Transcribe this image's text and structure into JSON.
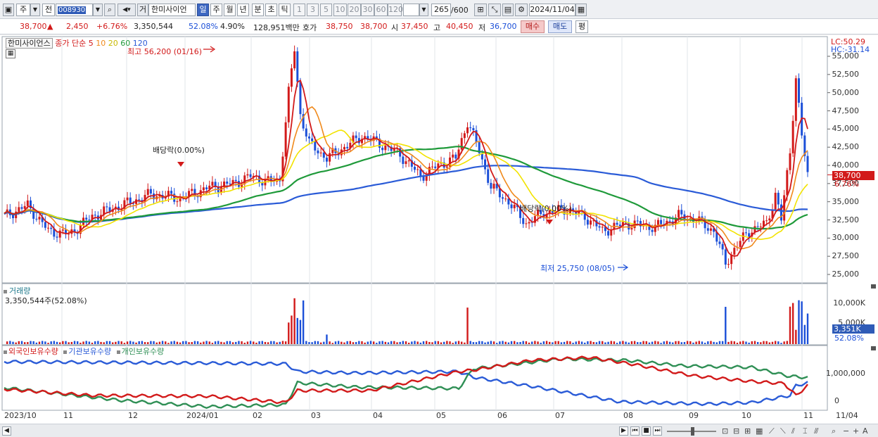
{
  "toolbar": {
    "market_type": "주",
    "compare": "전",
    "code": "008930",
    "mode_label": "거",
    "stock_name": "한미사이언",
    "periods": [
      "일",
      "주",
      "월",
      "년",
      "분",
      "초",
      "틱"
    ],
    "active_period": "일",
    "intervals": [
      "1",
      "3",
      "5",
      "10",
      "20",
      "30",
      "60",
      "120"
    ],
    "count": "265",
    "count_max": "/600",
    "date": "2024/11/04"
  },
  "quote": {
    "price": "38,700",
    "arrow": "▲",
    "change": "2,450",
    "change_pct": "+6.76%",
    "volume": "3,350,544",
    "vol_ratio": "52.08%",
    "turnover": "4.90%",
    "amount": "128,951백만",
    "ask_label": "호가",
    "ask1": "38,750",
    "ask2": "38,700",
    "open_label": "시",
    "open": "37,450",
    "high_label": "고",
    "high": "40,450",
    "low_label": "저",
    "low": "36,700",
    "buy": "매수",
    "sell": "매도",
    "eval": "평"
  },
  "price_panel": {
    "stock_name": "한미사이언스",
    "ma_label": "종가 단순",
    "ma_periods": [
      "5",
      "10",
      "20",
      "60",
      "120"
    ],
    "lc": "LC:50.29",
    "hc": "HC:-31.14",
    "yticks": [
      "55,000",
      "52,500",
      "50,000",
      "47,500",
      "45,000",
      "42,500",
      "40,000",
      "37,500",
      "35,000",
      "32,500",
      "30,000",
      "27,500",
      "25,000"
    ],
    "last_price": "38,700",
    "last_pct": "6.76%",
    "high_marker": "최고 56,200 (01/16)",
    "low_marker": "최저 25,750 (08/05)",
    "dividend1": "배당락(0.00%)",
    "dividend2": "배당락(0.00%)"
  },
  "volume_panel": {
    "title": "거래량",
    "info": "3,350,544주(52.08%)",
    "yticks": [
      "10,000K",
      "5,000K"
    ],
    "last": "3,351K",
    "last_pct": "52.08%"
  },
  "holding_panel": {
    "legend": [
      "외국인보유수량",
      "기관보유수량",
      "개인보유수량"
    ],
    "yticks": [
      "1,000,000",
      "0"
    ]
  },
  "dates": [
    "2023/10",
    "11",
    "12",
    "2024/01",
    "02",
    "03",
    "04",
    "05",
    "06",
    "07",
    "08",
    "09",
    "10",
    "11",
    "11/04"
  ],
  "colors": {
    "up": "#d21a1a",
    "down": "#1b4fd8",
    "ma5": "#d21a1a",
    "ma10": "#f08a1c",
    "ma20": "#f2e300",
    "ma60": "#1f9a3a",
    "ma120": "#2a5bd7",
    "foreign": "#d21a1a",
    "institution": "#2a5bd7",
    "individual": "#2f8f55"
  }
}
